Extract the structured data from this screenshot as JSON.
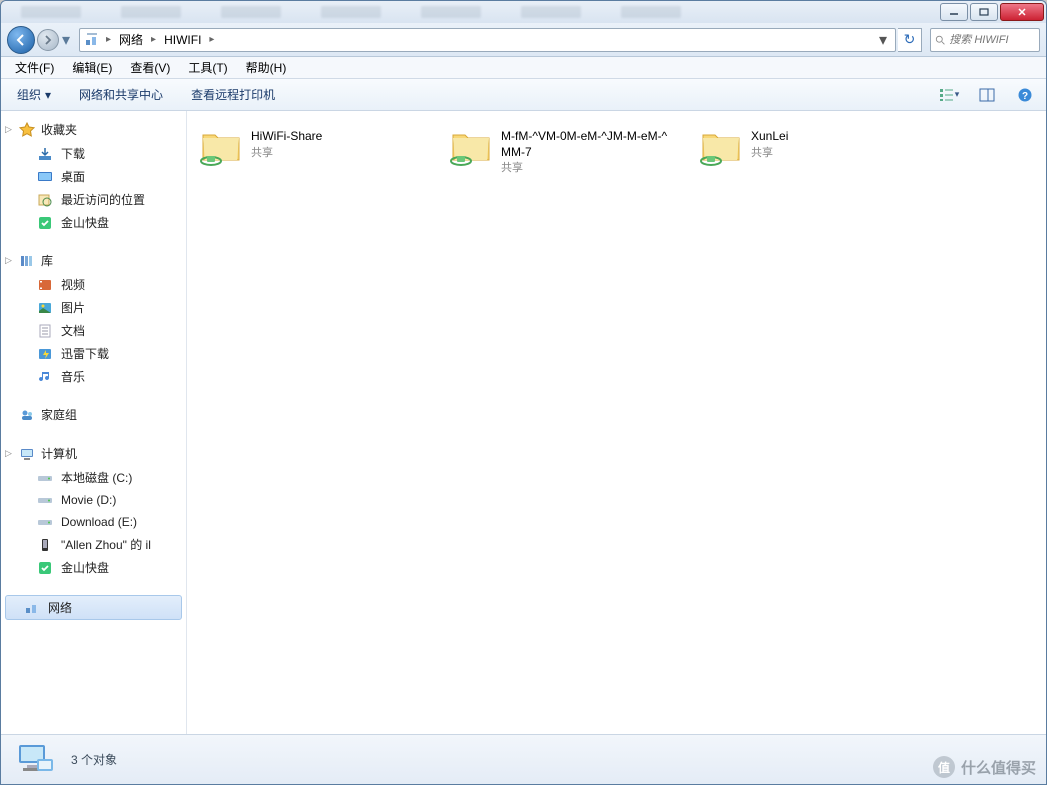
{
  "breadcrumbs": [
    "网络",
    "HIWIFI"
  ],
  "search_placeholder": "搜索 HIWIFI",
  "menubar": [
    "文件(F)",
    "编辑(E)",
    "查看(V)",
    "工具(T)",
    "帮助(H)"
  ],
  "toolbar": {
    "organize": "组织",
    "network_center": "网络和共享中心",
    "view_printers": "查看远程打印机"
  },
  "sidebar": {
    "favorites": {
      "label": "收藏夹",
      "items": [
        "下载",
        "桌面",
        "最近访问的位置",
        "金山快盘"
      ]
    },
    "libraries": {
      "label": "库",
      "items": [
        "视频",
        "图片",
        "文档",
        "迅雷下载",
        "音乐"
      ]
    },
    "homegroup": {
      "label": "家庭组"
    },
    "computer": {
      "label": "计算机",
      "items": [
        "本地磁盘 (C:)",
        "Movie (D:)",
        "Download (E:)",
        "\"Allen Zhou\" 的 il",
        "金山快盘"
      ]
    },
    "network": {
      "label": "网络"
    }
  },
  "content": {
    "items": [
      {
        "name": "HiWiFi-Share",
        "sub": "共享"
      },
      {
        "name": "M-fM-^VM-0M-eM-^JM-M-eM-^MM-7",
        "sub": "共享"
      },
      {
        "name": "XunLei",
        "sub": "共享"
      }
    ]
  },
  "statusbar": {
    "text": "3 个对象"
  },
  "watermark": {
    "text": "什么值得买",
    "badge": "值"
  }
}
